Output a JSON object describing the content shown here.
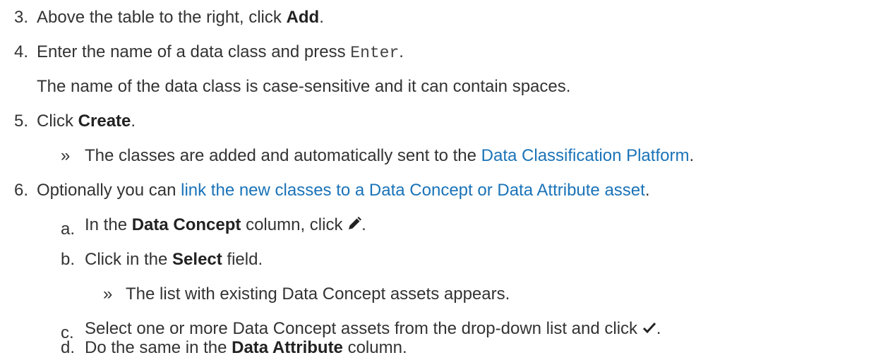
{
  "steps": {
    "s3": {
      "num": "3.",
      "pre": "Above the table to the right, click ",
      "bold": "Add",
      "post": "."
    },
    "s4": {
      "num": "4.",
      "pre": "Enter the name of a data class and press ",
      "code": "Enter",
      "post": "."
    },
    "s4_note": "The name of the data class is case-sensitive and it can contain spaces.",
    "s5": {
      "num": "5.",
      "pre": "Click ",
      "bold": "Create",
      "post": "."
    },
    "s5_result": {
      "marker": "»",
      "pre": "The classes are added and automatically sent to the ",
      "link": "Data Classification Platform",
      "post": "."
    },
    "s6": {
      "num": "6.",
      "pre": "Optionally you can ",
      "link": "link the new classes to a Data Concept or Data Attribute asset",
      "post": "."
    },
    "a": {
      "num": "a.",
      "pre": "In the ",
      "bold": "Data Concept",
      "mid": " column, click ",
      "icon": "pencil-icon",
      "post": "."
    },
    "b": {
      "num": "b.",
      "pre": "Click in the ",
      "bold": "Select",
      "post": " field."
    },
    "b_result": {
      "marker": "»",
      "text": "The list with existing Data Concept assets appears."
    },
    "c": {
      "num": "c.",
      "pre": "Select one or more Data Concept assets from the drop-down list and click ",
      "icon": "checkmark-icon",
      "post": "."
    },
    "d": {
      "num": "d.",
      "pre": "Do the same in the ",
      "bold": "Data Attribute",
      "post": " column."
    }
  },
  "colors": {
    "text": "#333333",
    "link": "#1a73b8"
  }
}
